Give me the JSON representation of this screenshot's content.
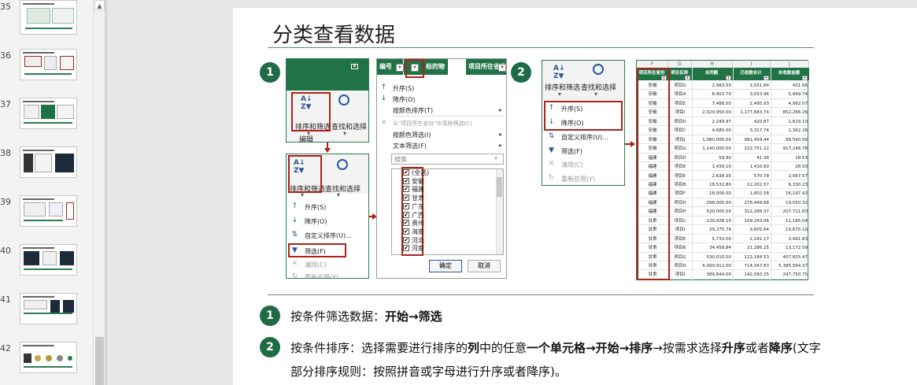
{
  "thumbnails": [
    {
      "num": "35"
    },
    {
      "num": "36"
    },
    {
      "num": "37"
    },
    {
      "num": "38"
    },
    {
      "num": "39"
    },
    {
      "num": "40"
    },
    {
      "num": "41"
    },
    {
      "num": "42"
    }
  ],
  "slide": {
    "title": "分类查看数据",
    "badge1": "1",
    "badge2": "2",
    "ribbon": {
      "sort_filter": "排序和筛选",
      "find_select": "查找和选择",
      "edit_group": "编辑"
    },
    "menu": {
      "asc": "升序(S)",
      "desc": "降序(O)",
      "custom": "自定义排序(U)...",
      "filter": "筛选(F)",
      "clear": "清除(C)",
      "reapply": "重新应用(Y)"
    },
    "filter_panel": {
      "col1": "编号",
      "col2": "标的物名称",
      "col3": "项目所在省份",
      "asc": "升序(S)",
      "desc": "降序(O)",
      "by_color": "按颜色排序(T)",
      "clear_from": "从\"项目所在省份\"中清除筛选(C)",
      "color_filter": "按颜色筛选(I)",
      "text_filter": "文本筛选(F)",
      "search": "搜索",
      "items": [
        "(全选)",
        "安徽",
        "福建",
        "甘肃",
        "广东",
        "广西",
        "贵州",
        "海南",
        "河北",
        "河南"
      ],
      "ok": "确定",
      "cancel": "取消"
    },
    "table": {
      "col_letters": [
        "F",
        "G",
        "H",
        "I",
        "J"
      ],
      "headers": [
        "项目所在省份",
        "项目名称",
        "合同额",
        "已收款合计",
        "未收款金额"
      ],
      "rows": [
        [
          "安徽",
          "项目G",
          "2,983.50",
          "2,551.84",
          "431.66"
        ],
        [
          "安徽",
          "项目A",
          "8,903.70",
          "3,053.96",
          "5,849.74"
        ],
        [
          "安徽",
          "项目E",
          "7,488.00",
          "2,495.93",
          "4,992.07"
        ],
        [
          "安徽",
          "项目I",
          "2,029,950.00",
          "1,177,683.74",
          "852,266.26"
        ],
        [
          "安徽",
          "项目D",
          "2,249.97",
          "420.87",
          "1,829.10"
        ],
        [
          "安徽",
          "项目C",
          "4,680.00",
          "3,317.74",
          "1,362.26"
        ],
        [
          "安徽",
          "项目J",
          "1,080,000.00",
          "981,459.44",
          "98,540.56"
        ],
        [
          "安徽",
          "项目G",
          "1,140,000.00",
          "222,751.22",
          "917,248.78"
        ],
        [
          "福建",
          "项目D",
          "59.90",
          "41.38",
          "18.53"
        ],
        [
          "福建",
          "项目E",
          "1,439.10",
          "1,410.60",
          "28.50"
        ],
        [
          "福建",
          "项目E",
          "2,638.35",
          "570.78",
          "2,067.57"
        ],
        [
          "福建",
          "项目B",
          "18,532.80",
          "12,202.57",
          "6,330.23"
        ],
        [
          "福建",
          "项目F",
          "18,000.00",
          "1,802.58",
          "16,197.42"
        ],
        [
          "福建",
          "项目D",
          "298,000.00",
          "278,449.68",
          "19,550.32"
        ],
        [
          "福建",
          "项目H",
          "520,000.00",
          "312,288.37",
          "207,711.63"
        ],
        [
          "甘肃",
          "项目C",
          "120,428.10",
          "109,243.06",
          "11,185.04"
        ],
        [
          "甘肃",
          "项目I",
          "29,275.74",
          "9,605.64",
          "19,670.10"
        ],
        [
          "甘肃",
          "项目E",
          "5,733.00",
          "2,241.17",
          "3,491.83"
        ],
        [
          "甘肃",
          "项目B",
          "34,458.84",
          "21,286.25",
          "13,172.59"
        ],
        [
          "甘肃",
          "项目G",
          "530,010.00",
          "122,184.53",
          "407,825.47"
        ],
        [
          "甘肃",
          "项目D",
          "6,099,912.00",
          "714,347.63",
          "5,385,564.37"
        ],
        [
          "甘肃",
          "项目I",
          "389,844.00",
          "142,093.25",
          "247,750.75"
        ]
      ]
    },
    "steps": [
      {
        "num": "1",
        "prefix": "按条件筛选数据：",
        "bold": "开始→筛选"
      },
      {
        "num": "2",
        "line1_a": "按条件排序：选择需要进行排序的",
        "line1_b": "列",
        "line1_c": "中的任意",
        "line1_d": "一个单元格",
        "line1_e": "→",
        "line1_f": "开始",
        "line1_g": "→",
        "line1_h": "排序",
        "line1_i": "→按需求选择",
        "line1_j": "升序",
        "line1_k": "或者",
        "line1_l": "降序",
        "line1_m": "(文字",
        "line2": "部分排序规则：按照拼音或字母进行升序或者降序)。"
      }
    ]
  }
}
